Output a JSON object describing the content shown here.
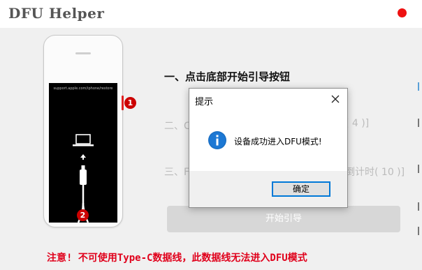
{
  "window": {
    "title": "DFU Helper",
    "close_color": "#ee1111"
  },
  "phone": {
    "screen_url": "support.apple.com/iphone/restore",
    "badge_side": "1",
    "badge_bottom": "2",
    "icons": [
      "laptop-icon",
      "arrow-up-icon",
      "lightning-cable-icon"
    ]
  },
  "steps": {
    "step1": "一、点击底部开始引导按钮",
    "step2_prefix": "二、C",
    "step2_suffix": "( 4 )]",
    "step3_prefix": "三、F",
    "step3_suffix": "倒计时( 10 )]"
  },
  "start_button": {
    "label": "开始引导"
  },
  "warning": "注意! 不可使用Type-C数据线，此数据线无法进入DFU模式",
  "dialog": {
    "title": "提示",
    "message": "设备成功进入DFU模式!",
    "ok_label": "确定",
    "icon": "info-icon"
  },
  "colors": {
    "accent_blue": "#0078d7",
    "warning_red": "#e0001b",
    "badge_red": "#cc0000"
  }
}
